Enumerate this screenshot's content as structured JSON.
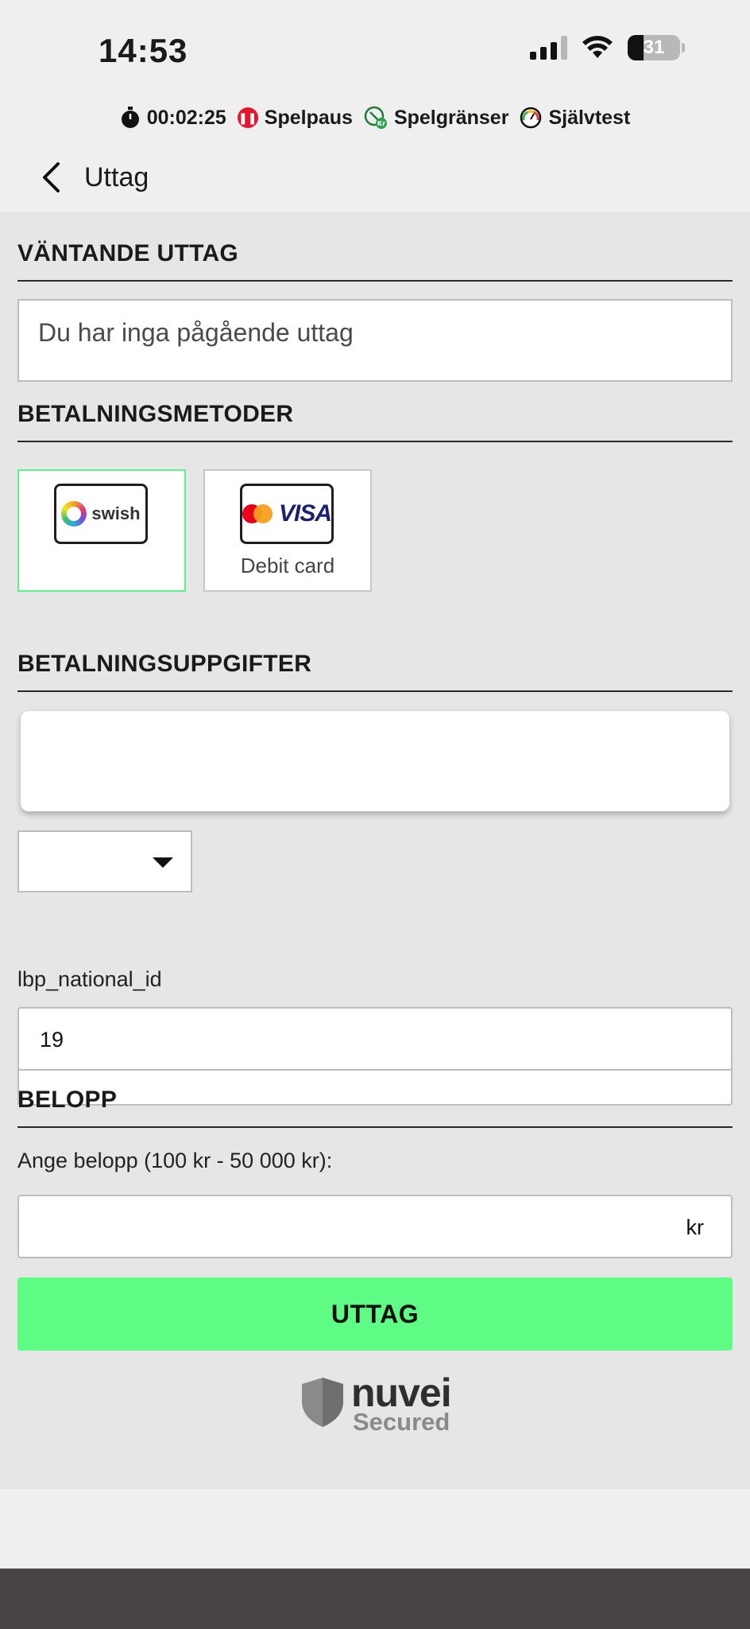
{
  "status_bar": {
    "time": "14:53",
    "battery_level": "31",
    "battery_fraction": 0.31
  },
  "responsible_gaming": {
    "session_time": "00:02:25",
    "pause_label": "Spelpaus",
    "limits_label": "Spelgränser",
    "selftest_label": "Självtest"
  },
  "nav": {
    "title": "Uttag"
  },
  "pending": {
    "title": "VÄNTANDE UTTAG",
    "message": "Du har inga pågående uttag"
  },
  "methods": {
    "title": "BETALNINGSMETODER",
    "items": [
      {
        "logo_text": "swish",
        "label": "",
        "selected": true
      },
      {
        "logo_text": "VISA",
        "label": "Debit card",
        "selected": false
      }
    ]
  },
  "details": {
    "title": "BETALNINGSUPPGIFTER",
    "card_value": "",
    "select_value": "",
    "phone_value": "",
    "national_id_label": "lbp_national_id",
    "national_id_value": "19"
  },
  "amount": {
    "title": "BELOPP",
    "label": "Ange belopp (100 kr - 50 000 kr):",
    "value": "",
    "currency": "kr"
  },
  "submit_label": "UTTAG",
  "secured": {
    "brand": "nuvei",
    "tagline": "Secured"
  },
  "colors": {
    "accent": "#5efc84",
    "selected_border": "#5cf285",
    "section_bg": "#e6e6e6",
    "header_bg": "#efefef"
  }
}
